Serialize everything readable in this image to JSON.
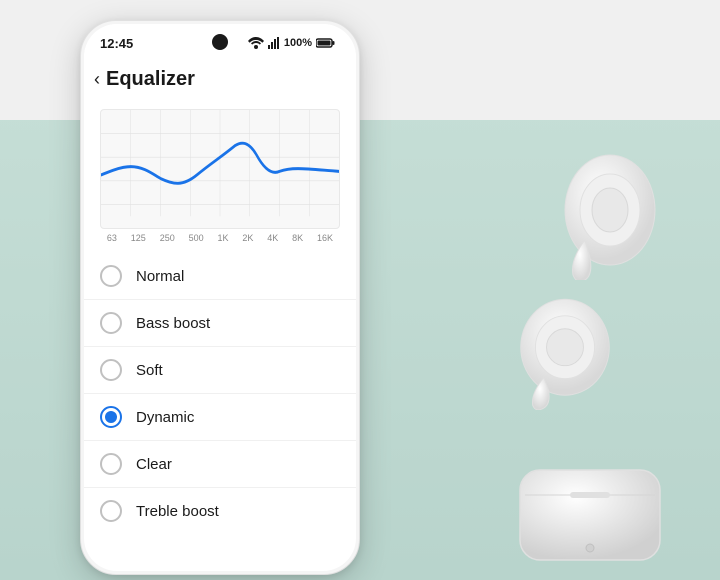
{
  "status_bar": {
    "time": "12:45",
    "battery": "100%",
    "signal": "WiFi + LTE"
  },
  "header": {
    "back_label": "‹",
    "title": "Equalizer"
  },
  "eq_chart": {
    "labels": [
      "63",
      "125",
      "250",
      "500",
      "1K",
      "2K",
      "4K",
      "8K",
      "16K"
    ]
  },
  "eq_options": [
    {
      "id": "normal",
      "label": "Normal",
      "selected": false
    },
    {
      "id": "bass-boost",
      "label": "Bass boost",
      "selected": false
    },
    {
      "id": "soft",
      "label": "Soft",
      "selected": false
    },
    {
      "id": "dynamic",
      "label": "Dynamic",
      "selected": true
    },
    {
      "id": "clear",
      "label": "Clear",
      "selected": false
    },
    {
      "id": "treble-boost",
      "label": "Treble boost",
      "selected": false
    }
  ],
  "colors": {
    "accent": "#1a73e8",
    "bg": "#b8d4cc",
    "phone_bg": "#ffffff"
  }
}
